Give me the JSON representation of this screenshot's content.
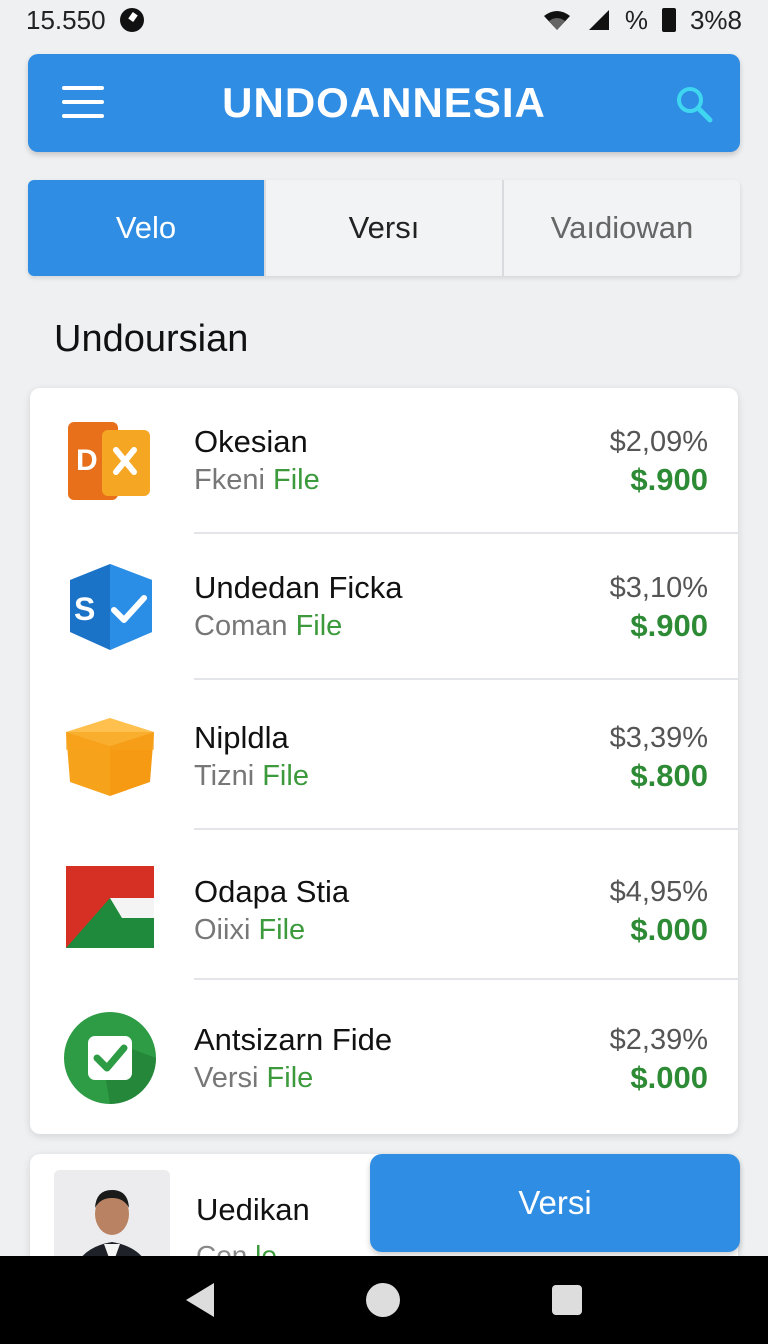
{
  "status_bar": {
    "time": "15.550",
    "signal_text": "%",
    "battery_text": "3%8"
  },
  "app_bar": {
    "title": "UNDOANNESIA"
  },
  "tabs": [
    {
      "label": "Velo",
      "active": true
    },
    {
      "label": "Versı",
      "active": false
    },
    {
      "label": "Vaıdiowan",
      "active": false
    }
  ],
  "section": {
    "title": "Undoursian"
  },
  "files": [
    {
      "name": "Okesian",
      "sub": "Fkeni",
      "tag": "File",
      "percent": "$2,09%",
      "price": "$.900",
      "icon": "office-document-icon"
    },
    {
      "name": "Undedan Ficka",
      "sub": "Coman",
      "tag": "File",
      "percent": "$3,10%",
      "price": "$.900",
      "icon": "sharepoint-icon"
    },
    {
      "name": "Nipldla",
      "sub": "Tizni",
      "tag": "File",
      "percent": "$3,39%",
      "price": "$.800",
      "icon": "box-icon"
    },
    {
      "name": "Odapa Stia",
      "sub": "Oiixi",
      "tag": "File",
      "percent": "$4,95%",
      "price": "$.000",
      "icon": "flag-icon"
    },
    {
      "name": "Antsizarn Fide",
      "sub": "Versi",
      "tag": "File",
      "percent": "$2,39%",
      "price": "$.000",
      "icon": "check-icon"
    }
  ],
  "profile": {
    "name": "Uedikan",
    "sub": "Con",
    "tag": "le"
  },
  "action_button": {
    "label": "Versi"
  },
  "colors": {
    "primary": "#2f8de4",
    "positive": "#2e8b35"
  }
}
